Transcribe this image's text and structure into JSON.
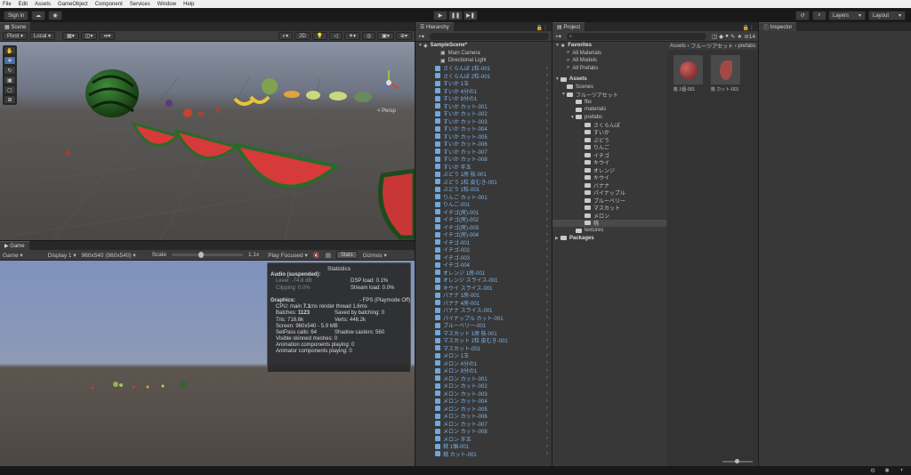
{
  "menu": [
    "File",
    "Edit",
    "Assets",
    "GameObject",
    "Component",
    "Services",
    "Window",
    "Help"
  ],
  "toolbar": {
    "signin": "Sign in",
    "layers": "Layers",
    "layout": "Layout"
  },
  "scene": {
    "tab": "Scene",
    "pivot": "Pivot",
    "local": "Local",
    "mode_2d": "2D",
    "persp": "< Persp"
  },
  "game": {
    "tab": "Game",
    "display_mode": "Game",
    "display": "Display 1",
    "resolution": "960x540 (960x540)",
    "scale_label": "Scale",
    "scale_value": "1.1x",
    "play": "Play Focused",
    "stats": "Stats",
    "gizmos": "Gizmos"
  },
  "stats": {
    "title": "Statistics",
    "audio": "Audio (suspended):",
    "level": "Level: -74.8 dB",
    "dsp": "DSP load: 0.1%",
    "clipping": "Clipping: 0.0%",
    "stream": "Stream load: 0.0%",
    "graphics": "Graphics:",
    "fps": "- FPS (Playmode Off)",
    "cpu_a": "CPU: main ",
    "cpu_b": "7.1",
    "cpu_c": "ms  render thread 1.6ms",
    "batches_a": "Batches: ",
    "batches_b": "1123",
    "saved": "Saved by batching: 0",
    "tris": "Tris: 718.6k",
    "verts": "Verts: 446.2k",
    "screen": "Screen: 960x540 - 5.9 MB",
    "setpass": "SetPass calls: 64",
    "shadow": "Shadow casters: 560",
    "skinned": "Visible skinned meshes: 0",
    "anim": "Animation components playing: 0",
    "animator": "Animator components playing: 0"
  },
  "hierarchy": {
    "tab": "Hierarchy",
    "scene": "SampleScene*",
    "camera": "Main Camera",
    "light": "Directional Light",
    "items": [
      "さくらんぼ 1粒-001",
      "さくらんぼ 2粒-001",
      "すいか 1玉",
      "すいか 4分の1",
      "すいか 8分の1",
      "すいか カット-001",
      "すいか カット-002",
      "すいか カット-003",
      "すいか カット-004",
      "すいか カット-005",
      "すいか カット-006",
      "すいか カット-007",
      "すいか カット-008",
      "すいか 半玉",
      "ぶどう 1房 枝-001",
      "ぶどう 1粒 皮むき-001",
      "ぶどう 1粒-001",
      "りんご カット-001",
      "りんご-001",
      "イチゴ(房)-001",
      "イチゴ(房)-002",
      "イチゴ(房)-003",
      "イチゴ(房)-004",
      "イチゴ-001",
      "イチゴ-002",
      "イチゴ-003",
      "イチゴ-004",
      "オレンジ 1房-001",
      "オレンジ スライス-001",
      "キウイ スライス-001",
      "バナナ 1房-001",
      "バナナ 4房-001",
      "バナナ スライス-001",
      "パイナップル カット-001",
      "ブルーベリー-001",
      "マスカット 1房 枝-001",
      "マスカット 1粒 皮むき-001",
      "マスカット-001",
      "メロン 1玉",
      "メロン 4分の1",
      "メロン 8分の1",
      "メロン カット-001",
      "メロン カット-002",
      "メロン カット-003",
      "メロン カット-004",
      "メロン カット-005",
      "メロン カット-006",
      "メロン カット-007",
      "メロン カット-008",
      "メロン 半玉",
      "桃 1個-001",
      "桃 カット-001"
    ]
  },
  "project": {
    "tab": "Project",
    "count": "14",
    "favorites": "Favorites",
    "fav_items": [
      "All Materials",
      "All Models",
      "All Prefabs"
    ],
    "assets": "Assets",
    "scenes": "Scenes",
    "fruit": "フルーツアセット",
    "fbx": "fbx",
    "materials": "materials",
    "prefabs": "prefabs",
    "prefab_folders": [
      "さくらんぼ",
      "すいか",
      "ぶどう",
      "りんご",
      "イチゴ",
      "キウイ",
      "オレンジ",
      "キウイ",
      "バナナ",
      "パイナップル",
      "ブルーベリー",
      "マスカット",
      "メロン",
      "桃"
    ],
    "textures": "textures",
    "packages": "Packages",
    "breadcrumb": [
      "Assets",
      "フルーツアセット",
      "prefabs"
    ],
    "assets_grid": [
      {
        "label": "桃 1個-001",
        "color": "#a83a3a"
      },
      {
        "label": "桃 カット-001",
        "color": "#9a4a44"
      }
    ]
  },
  "inspector": {
    "tab": "Inspector"
  }
}
